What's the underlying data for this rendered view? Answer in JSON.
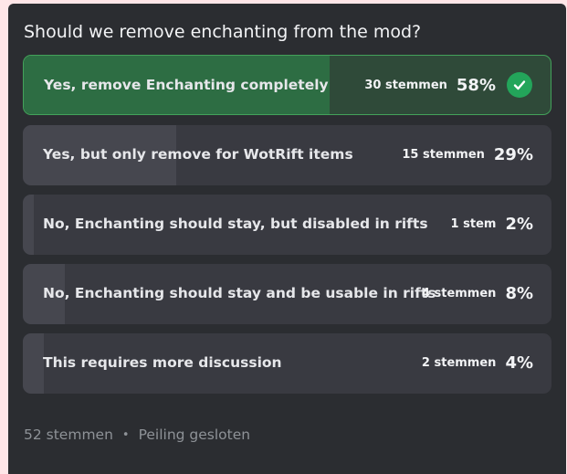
{
  "poll": {
    "question": "Should we remove enchanting from the mod?",
    "answers": [
      {
        "label": "Yes, remove Enchanting completely",
        "votes": "30 stemmen",
        "percent": "58%",
        "share": 0.58,
        "selected": true
      },
      {
        "label": "Yes, but only remove for WotRift items",
        "votes": "15 stemmen",
        "percent": "29%",
        "share": 0.29,
        "selected": false
      },
      {
        "label": "No, Enchanting should stay, but disabled in rifts",
        "votes": "1 stem",
        "percent": "2%",
        "share": 0.02,
        "selected": false
      },
      {
        "label": "No, Enchanting should stay and be usable in rifts",
        "votes": "4 stemmen",
        "percent": "8%",
        "share": 0.08,
        "selected": false
      },
      {
        "label": "This requires more discussion",
        "votes": "2 stemmen",
        "percent": "4%",
        "share": 0.04,
        "selected": false
      }
    ],
    "footer": {
      "total_votes": "52 stemmen",
      "separator": "•",
      "status": "Peiling gesloten"
    }
  },
  "colors": {
    "winner_border": "#43a25a",
    "check_bg": "#23a55a",
    "card_bg": "#2b2d31"
  },
  "icons": {
    "winner": "checkmark-icon"
  }
}
